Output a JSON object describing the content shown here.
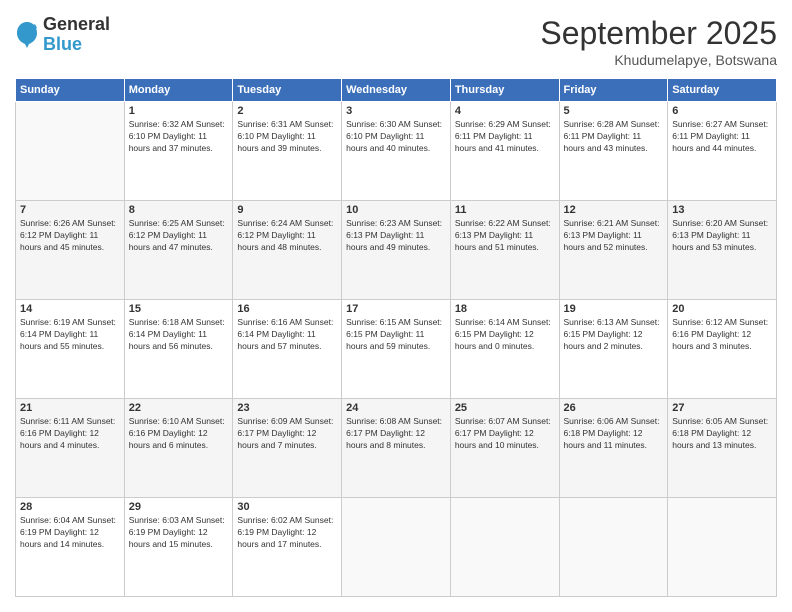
{
  "header": {
    "logo_general": "General",
    "logo_blue": "Blue",
    "title": "September 2025",
    "location": "Khudumelapye, Botswana"
  },
  "weekdays": [
    "Sunday",
    "Monday",
    "Tuesday",
    "Wednesday",
    "Thursday",
    "Friday",
    "Saturday"
  ],
  "weeks": [
    [
      {
        "day": "",
        "text": ""
      },
      {
        "day": "1",
        "text": "Sunrise: 6:32 AM\nSunset: 6:10 PM\nDaylight: 11 hours\nand 37 minutes."
      },
      {
        "day": "2",
        "text": "Sunrise: 6:31 AM\nSunset: 6:10 PM\nDaylight: 11 hours\nand 39 minutes."
      },
      {
        "day": "3",
        "text": "Sunrise: 6:30 AM\nSunset: 6:10 PM\nDaylight: 11 hours\nand 40 minutes."
      },
      {
        "day": "4",
        "text": "Sunrise: 6:29 AM\nSunset: 6:11 PM\nDaylight: 11 hours\nand 41 minutes."
      },
      {
        "day": "5",
        "text": "Sunrise: 6:28 AM\nSunset: 6:11 PM\nDaylight: 11 hours\nand 43 minutes."
      },
      {
        "day": "6",
        "text": "Sunrise: 6:27 AM\nSunset: 6:11 PM\nDaylight: 11 hours\nand 44 minutes."
      }
    ],
    [
      {
        "day": "7",
        "text": "Sunrise: 6:26 AM\nSunset: 6:12 PM\nDaylight: 11 hours\nand 45 minutes."
      },
      {
        "day": "8",
        "text": "Sunrise: 6:25 AM\nSunset: 6:12 PM\nDaylight: 11 hours\nand 47 minutes."
      },
      {
        "day": "9",
        "text": "Sunrise: 6:24 AM\nSunset: 6:12 PM\nDaylight: 11 hours\nand 48 minutes."
      },
      {
        "day": "10",
        "text": "Sunrise: 6:23 AM\nSunset: 6:13 PM\nDaylight: 11 hours\nand 49 minutes."
      },
      {
        "day": "11",
        "text": "Sunrise: 6:22 AM\nSunset: 6:13 PM\nDaylight: 11 hours\nand 51 minutes."
      },
      {
        "day": "12",
        "text": "Sunrise: 6:21 AM\nSunset: 6:13 PM\nDaylight: 11 hours\nand 52 minutes."
      },
      {
        "day": "13",
        "text": "Sunrise: 6:20 AM\nSunset: 6:13 PM\nDaylight: 11 hours\nand 53 minutes."
      }
    ],
    [
      {
        "day": "14",
        "text": "Sunrise: 6:19 AM\nSunset: 6:14 PM\nDaylight: 11 hours\nand 55 minutes."
      },
      {
        "day": "15",
        "text": "Sunrise: 6:18 AM\nSunset: 6:14 PM\nDaylight: 11 hours\nand 56 minutes."
      },
      {
        "day": "16",
        "text": "Sunrise: 6:16 AM\nSunset: 6:14 PM\nDaylight: 11 hours\nand 57 minutes."
      },
      {
        "day": "17",
        "text": "Sunrise: 6:15 AM\nSunset: 6:15 PM\nDaylight: 11 hours\nand 59 minutes."
      },
      {
        "day": "18",
        "text": "Sunrise: 6:14 AM\nSunset: 6:15 PM\nDaylight: 12 hours\nand 0 minutes."
      },
      {
        "day": "19",
        "text": "Sunrise: 6:13 AM\nSunset: 6:15 PM\nDaylight: 12 hours\nand 2 minutes."
      },
      {
        "day": "20",
        "text": "Sunrise: 6:12 AM\nSunset: 6:16 PM\nDaylight: 12 hours\nand 3 minutes."
      }
    ],
    [
      {
        "day": "21",
        "text": "Sunrise: 6:11 AM\nSunset: 6:16 PM\nDaylight: 12 hours\nand 4 minutes."
      },
      {
        "day": "22",
        "text": "Sunrise: 6:10 AM\nSunset: 6:16 PM\nDaylight: 12 hours\nand 6 minutes."
      },
      {
        "day": "23",
        "text": "Sunrise: 6:09 AM\nSunset: 6:17 PM\nDaylight: 12 hours\nand 7 minutes."
      },
      {
        "day": "24",
        "text": "Sunrise: 6:08 AM\nSunset: 6:17 PM\nDaylight: 12 hours\nand 8 minutes."
      },
      {
        "day": "25",
        "text": "Sunrise: 6:07 AM\nSunset: 6:17 PM\nDaylight: 12 hours\nand 10 minutes."
      },
      {
        "day": "26",
        "text": "Sunrise: 6:06 AM\nSunset: 6:18 PM\nDaylight: 12 hours\nand 11 minutes."
      },
      {
        "day": "27",
        "text": "Sunrise: 6:05 AM\nSunset: 6:18 PM\nDaylight: 12 hours\nand 13 minutes."
      }
    ],
    [
      {
        "day": "28",
        "text": "Sunrise: 6:04 AM\nSunset: 6:19 PM\nDaylight: 12 hours\nand 14 minutes."
      },
      {
        "day": "29",
        "text": "Sunrise: 6:03 AM\nSunset: 6:19 PM\nDaylight: 12 hours\nand 15 minutes."
      },
      {
        "day": "30",
        "text": "Sunrise: 6:02 AM\nSunset: 6:19 PM\nDaylight: 12 hours\nand 17 minutes."
      },
      {
        "day": "",
        "text": ""
      },
      {
        "day": "",
        "text": ""
      },
      {
        "day": "",
        "text": ""
      },
      {
        "day": "",
        "text": ""
      }
    ]
  ]
}
